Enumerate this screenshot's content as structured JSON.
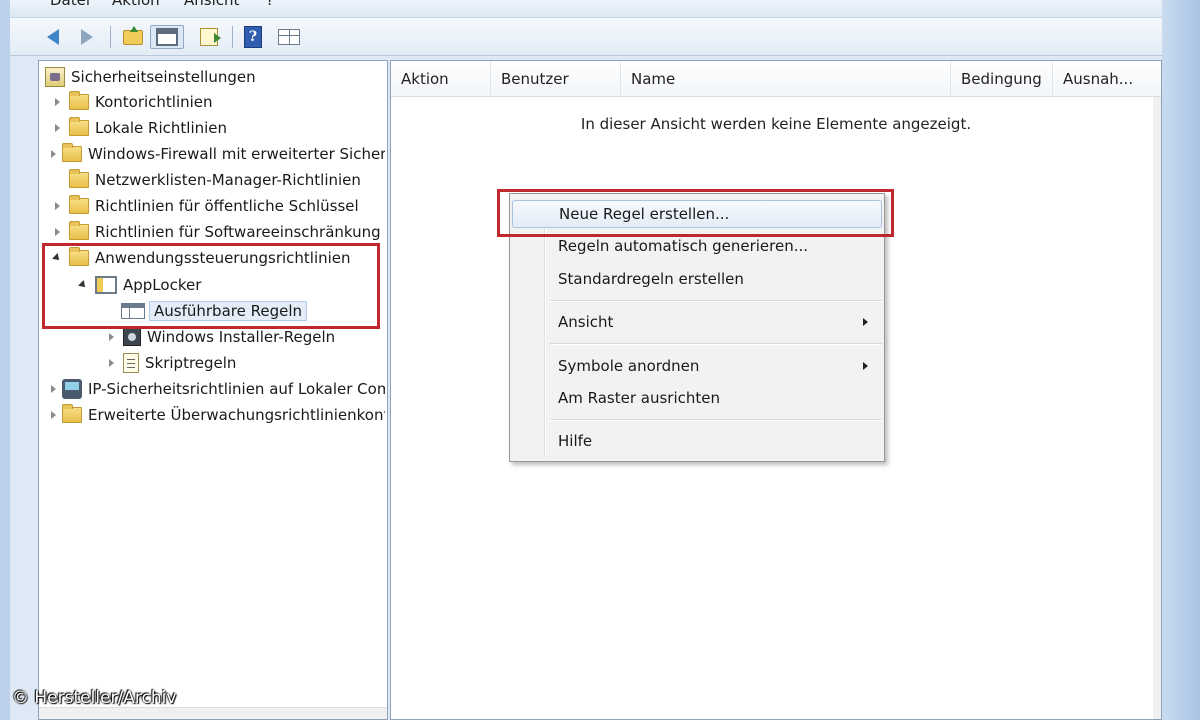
{
  "menubar": {
    "items": [
      "Datei",
      "Aktion",
      "Ansicht",
      "?"
    ]
  },
  "toolbar": {
    "buttons": [
      {
        "icon": "back-arrow-icon"
      },
      {
        "icon": "forward-arrow-icon"
      },
      {
        "icon": "up-folder-icon"
      },
      {
        "icon": "console-tree-icon"
      },
      {
        "icon": "export-list-icon"
      },
      {
        "icon": "help-icon",
        "glyph": "?"
      },
      {
        "icon": "action-pane-icon"
      }
    ]
  },
  "tree": {
    "root": "Sicherheitseinstellungen",
    "items": [
      {
        "label": "Kontorichtlinien"
      },
      {
        "label": "Lokale Richtlinien"
      },
      {
        "label": "Windows-Firewall mit erweiterter Sicherheit"
      },
      {
        "label": "Netzwerklisten-Manager-Richtlinien"
      },
      {
        "label": "Richtlinien für öffentliche Schlüssel"
      },
      {
        "label": "Richtlinien für Softwareeinschränkung"
      },
      {
        "label": "Anwendungssteuerungsrichtlinien"
      },
      {
        "label": "AppLocker"
      },
      {
        "label": "Ausführbare Regeln"
      },
      {
        "label": "Windows Installer-Regeln"
      },
      {
        "label": "Skriptregeln"
      },
      {
        "label": "IP-Sicherheitsrichtlinien auf Lokaler Computer"
      },
      {
        "label": "Erweiterte Überwachungsrichtlinienkonfiguration"
      }
    ]
  },
  "list": {
    "columns": [
      "Aktion",
      "Benutzer",
      "Name",
      "Bedingung",
      "Ausnah..."
    ],
    "empty_text": "In dieser Ansicht werden keine Elemente angezeigt."
  },
  "context_menu": {
    "items": [
      {
        "label": "Neue Regel erstellen..."
      },
      {
        "label": "Regeln automatisch generieren..."
      },
      {
        "label": "Standardregeln erstellen"
      },
      {
        "label": "Ansicht"
      },
      {
        "label": "Symbole anordnen"
      },
      {
        "label": "Am Raster ausrichten"
      },
      {
        "label": "Hilfe"
      }
    ]
  },
  "colors": {
    "highlight_box": "#c0282e",
    "folder": "#e8bf4b",
    "menu_bg": "#f2f2f2"
  },
  "copyright": "© Hersteller/Archiv"
}
